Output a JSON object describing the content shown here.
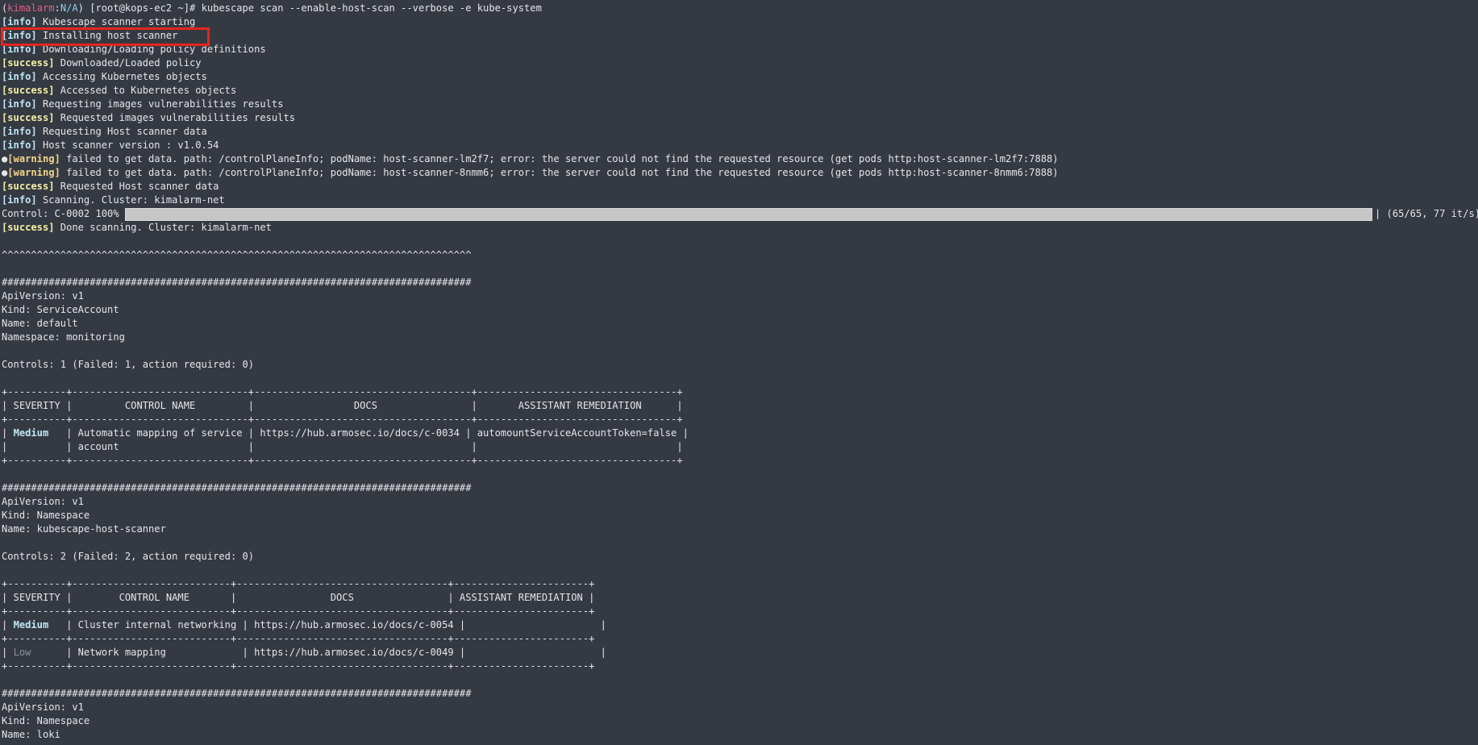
{
  "prompt": {
    "context": "kimalarm",
    "context_sep": ":",
    "region": "N/A",
    "user_host": "[root@kops-ec2 ~]# ",
    "command": "kubescape scan --enable-host-scan --verbose -e kube-system"
  },
  "log": [
    {
      "tag": "[info]",
      "msg": " Kubescape scanner starting"
    },
    {
      "tag": "[info]",
      "msg": " Installing host scanner"
    },
    {
      "tag": "[info]",
      "msg": " Downloading/Loading policy definitions"
    },
    {
      "tag": "[success]",
      "msg": " Downloaded/Loaded policy"
    },
    {
      "tag": "[info]",
      "msg": " Accessing Kubernetes objects"
    },
    {
      "tag": "[success]",
      "msg": " Accessed to Kubernetes objects"
    },
    {
      "tag": "[info]",
      "msg": " Requesting images vulnerabilities results"
    },
    {
      "tag": "[success]",
      "msg": " Requested images vulnerabilities results"
    },
    {
      "tag": "[info]",
      "msg": " Requesting Host scanner data"
    },
    {
      "tag": "[info]",
      "msg": " Host scanner version : v1.0.54"
    },
    {
      "tag": "[warning]",
      "msg": " failed to get data. path: /controlPlaneInfo; podName: host-scanner-lm2f7; error: the server could not find the requested resource (get pods http:host-scanner-lm2f7:7888)"
    },
    {
      "tag": "[warning]",
      "msg": " failed to get data. path: /controlPlaneInfo; podName: host-scanner-8nmm6; error: the server could not find the requested resource (get pods http:host-scanner-8nmm6:7888)"
    },
    {
      "tag": "[success]",
      "msg": " Requested Host scanner data"
    },
    {
      "tag": "[info]",
      "msg": " Scanning. Cluster: kimalarm-net"
    }
  ],
  "progress": {
    "label": "Control: C-0002 100% |",
    "percent": 100,
    "suffix": "| (65/65, 77 it/s)"
  },
  "done": {
    "tag": "[success]",
    "msg": " Done scanning. Cluster: kimalarm-net"
  },
  "tilde_line": "^^^^^^^^^^^^^^^^^^^^^^^^^^^^^^^^^^^^^^^^^^^^^^^^^^^^^^^^^^^^^^^^^^^^^^^^^^^^^^^^",
  "hash_line": "################################################################################",
  "resources": [
    {
      "api": "ApiVersion: v1",
      "kind": "Kind: ServiceAccount",
      "name": "Name: default",
      "ns": "Namespace: monitoring",
      "controls": "Controls: 1 (Failed: 1, action required: 0)",
      "t_border": "+----------+------------------------------+-------------------------------------+----------------------------------+",
      "t_header": "| SEVERITY |         CONTROL NAME         |                 DOCS                |       ASSISTANT REMEDIATION      |",
      "rows": [
        {
          "pre": "| ",
          "sev": "Medium",
          "post": "   | Automatic mapping of service | https://hub.armosec.io/docs/c-0034 | automountServiceAccountToken=false |"
        },
        {
          "pre": "|          | account                      |                                     |                                  |",
          "sev": "",
          "post": ""
        }
      ]
    },
    {
      "api": "ApiVersion: v1",
      "kind": "Kind: Namespace",
      "name": "Name: kubescape-host-scanner",
      "controls": "Controls: 2 (Failed: 2, action required: 0)",
      "t_border": "+----------+---------------------------+------------------------------------+-----------------------+",
      "t_header": "| SEVERITY |        CONTROL NAME       |                DOCS                | ASSISTANT REMEDIATION |",
      "rows": [
        {
          "pre": "| ",
          "sev": "Medium",
          "post": "   | Cluster internal networking | https://hub.armosec.io/docs/c-0054 |                       |"
        },
        {
          "pre": "| ",
          "sev": "Low",
          "post": "      | Network mapping             | https://hub.armosec.io/docs/c-0049 |                       |"
        }
      ]
    },
    {
      "api": "ApiVersion: v1",
      "kind": "Kind: Namespace",
      "name": "Name: loki"
    }
  ],
  "colors": {
    "background": "#353942",
    "highlight_box": "#e5261d",
    "info_tag": "#bfe6f7",
    "success_tag": "#f3f0a6",
    "prompt_context": "#e0608a"
  }
}
